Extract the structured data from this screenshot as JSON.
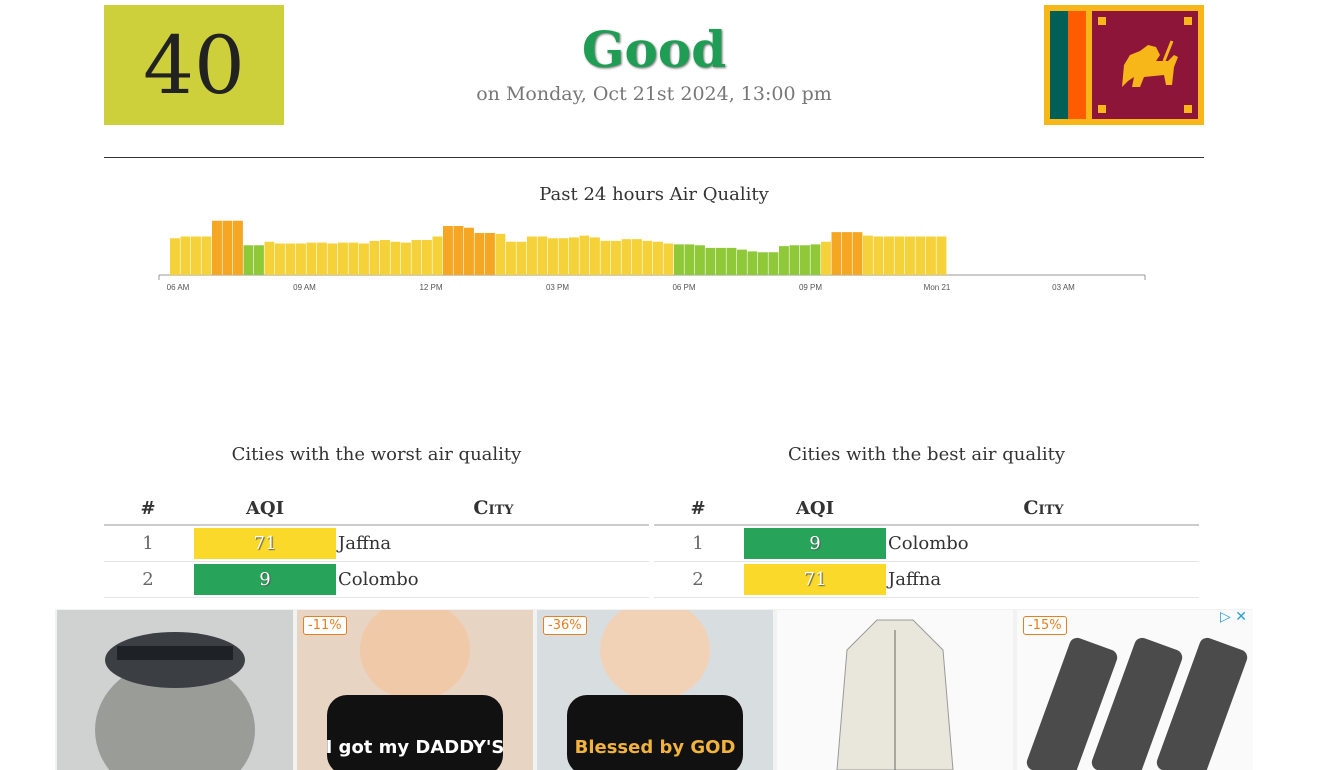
{
  "header": {
    "aqi": "40",
    "status": "Good",
    "updated": "on Monday, Oct 21st 2024, 13:00 pm"
  },
  "chart_data": {
    "type": "bar",
    "title": "Past 24 hours Air Quality",
    "x_tick_labels": [
      "06 AM",
      "09 AM",
      "12 PM",
      "03 PM",
      "06 PM",
      "09 PM",
      "Mon 21",
      "03 AM"
    ],
    "values": [
      42,
      44,
      44,
      44,
      62,
      62,
      62,
      34,
      34,
      38,
      36,
      36,
      36,
      37,
      37,
      36,
      37,
      37,
      36,
      39,
      40,
      38,
      37,
      40,
      40,
      44,
      56,
      56,
      54,
      48,
      48,
      47,
      38,
      38,
      44,
      44,
      42,
      42,
      43,
      45,
      43,
      39,
      39,
      41,
      41,
      39,
      38,
      36,
      35,
      35,
      34,
      31,
      31,
      31,
      29,
      27,
      26,
      26,
      33,
      34,
      34,
      35,
      38,
      49,
      49,
      49,
      45,
      44,
      44,
      44,
      44,
      44,
      44,
      44
    ],
    "colors": {
      "good": "#8fc93a",
      "moderate": "#f6d23a",
      "unhealthy": "#f5a623"
    },
    "ylim": [
      0,
      80
    ]
  },
  "worst": {
    "title": "Cities with the worst air quality",
    "headers": {
      "rank": "#",
      "aqi": "AQI",
      "city": "City"
    },
    "rows": [
      {
        "rank": "1",
        "aqi": "71",
        "city": "Jaffna",
        "color": "#fbd92a"
      },
      {
        "rank": "2",
        "aqi": "9",
        "city": "Colombo",
        "color": "#27a45a"
      }
    ]
  },
  "best": {
    "title": "Cities with the best air quality",
    "headers": {
      "rank": "#",
      "aqi": "AQI",
      "city": "City"
    },
    "rows": [
      {
        "rank": "1",
        "aqi": "9",
        "city": "Colombo",
        "color": "#27a45a"
      },
      {
        "rank": "2",
        "aqi": "71",
        "city": "Jaffna",
        "color": "#fbd92a"
      }
    ]
  },
  "ads": {
    "tiles": [
      {
        "discount": "",
        "caption": ""
      },
      {
        "discount": "-11%",
        "caption": "I got my DADDY'S"
      },
      {
        "discount": "-36%",
        "caption": "Blessed by GOD"
      },
      {
        "discount": "",
        "caption": ""
      },
      {
        "discount": "-15%",
        "caption": ""
      }
    ],
    "choices": "▷ ✕"
  }
}
